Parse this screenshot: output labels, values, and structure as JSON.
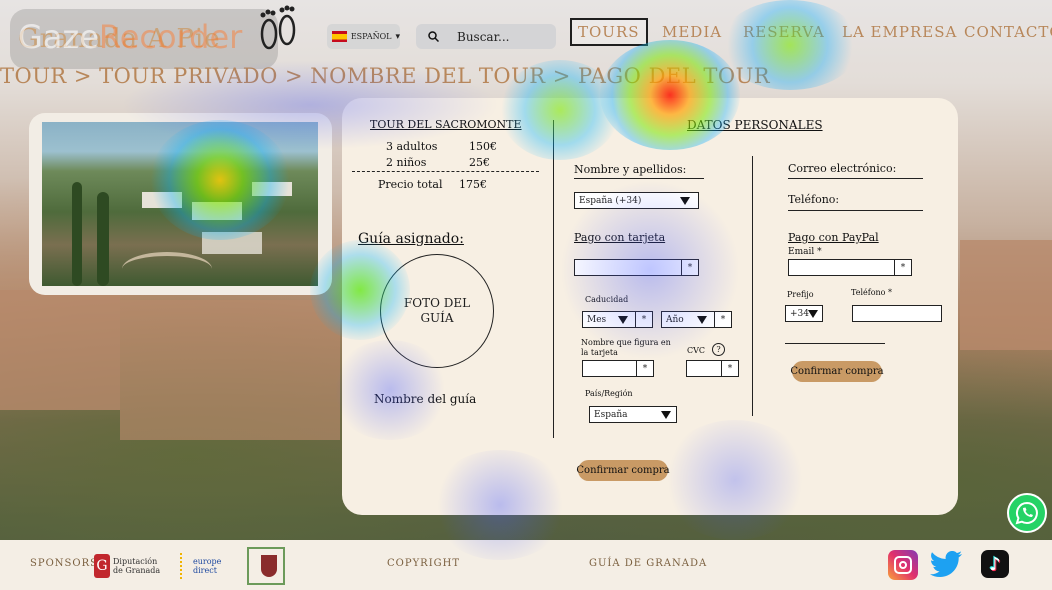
{
  "header": {
    "logo_text": "Granada A Pie",
    "language": {
      "label": "ESPAÑOL"
    },
    "search": {
      "placeholder": "Buscar..."
    },
    "nav": [
      "TOURS",
      "MEDIA",
      "RESERVA",
      "LA EMPRESA",
      "CONTACTO"
    ],
    "active_nav": "TOURS"
  },
  "breadcrumb": "TOUR > TOUR PRIVADO > NOMBRE DEL TOUR > PAGO DEL TOUR",
  "summary": {
    "tour_title": "TOUR DEL SACROMONTE",
    "lines": [
      {
        "label": "3 adultos",
        "price": "150€"
      },
      {
        "label": "2 niños",
        "price": "25€"
      }
    ],
    "total_label": "Precio total",
    "total_price": "175€",
    "guide_label": "Guía asignado:",
    "guide_photo": "FOTO DEL GUÍA",
    "guide_name": "Nombre del guía"
  },
  "personal": {
    "title": "DATOS PERSONALES",
    "name_label": "Nombre y apellidos:",
    "email_label": "Correo electrónico:",
    "phone_label": "Teléfono:",
    "country_select": "España (+34)"
  },
  "card_payment": {
    "title": "Pago con tarjeta",
    "star": "*",
    "expiry_label": "Caducidad",
    "month": "Mes",
    "year": "Año",
    "card_name_label": "Nombre que figura en la tarjeta",
    "cvc_label": "CVC",
    "help_icon": "?",
    "country_label": "País/Región",
    "country_value": "España",
    "confirm": "Confirmar compra"
  },
  "paypal": {
    "title": "Pago con PayPal",
    "email_label": "Email *",
    "prefix_label": "Prefijo",
    "prefix_value": "+34",
    "phone_label": "Teléfono *",
    "confirm": "Confirmar compra"
  },
  "footer": {
    "sponsors_label": "SPONSORS",
    "sponsor1_line1": "Diputación",
    "sponsor1_line2": "de Granada",
    "sponsor2_line1": "europe",
    "sponsor2_line2": "direct",
    "copyright": "COPYRIGHT",
    "guide": "GUÍA DE GRANADA"
  },
  "overlay": {
    "watermark_a": "Gaze",
    "watermark_b": "Recorder"
  },
  "colors": {
    "accent": "#b8875a",
    "card": "#f7efe3",
    "button": "#c99a65"
  }
}
